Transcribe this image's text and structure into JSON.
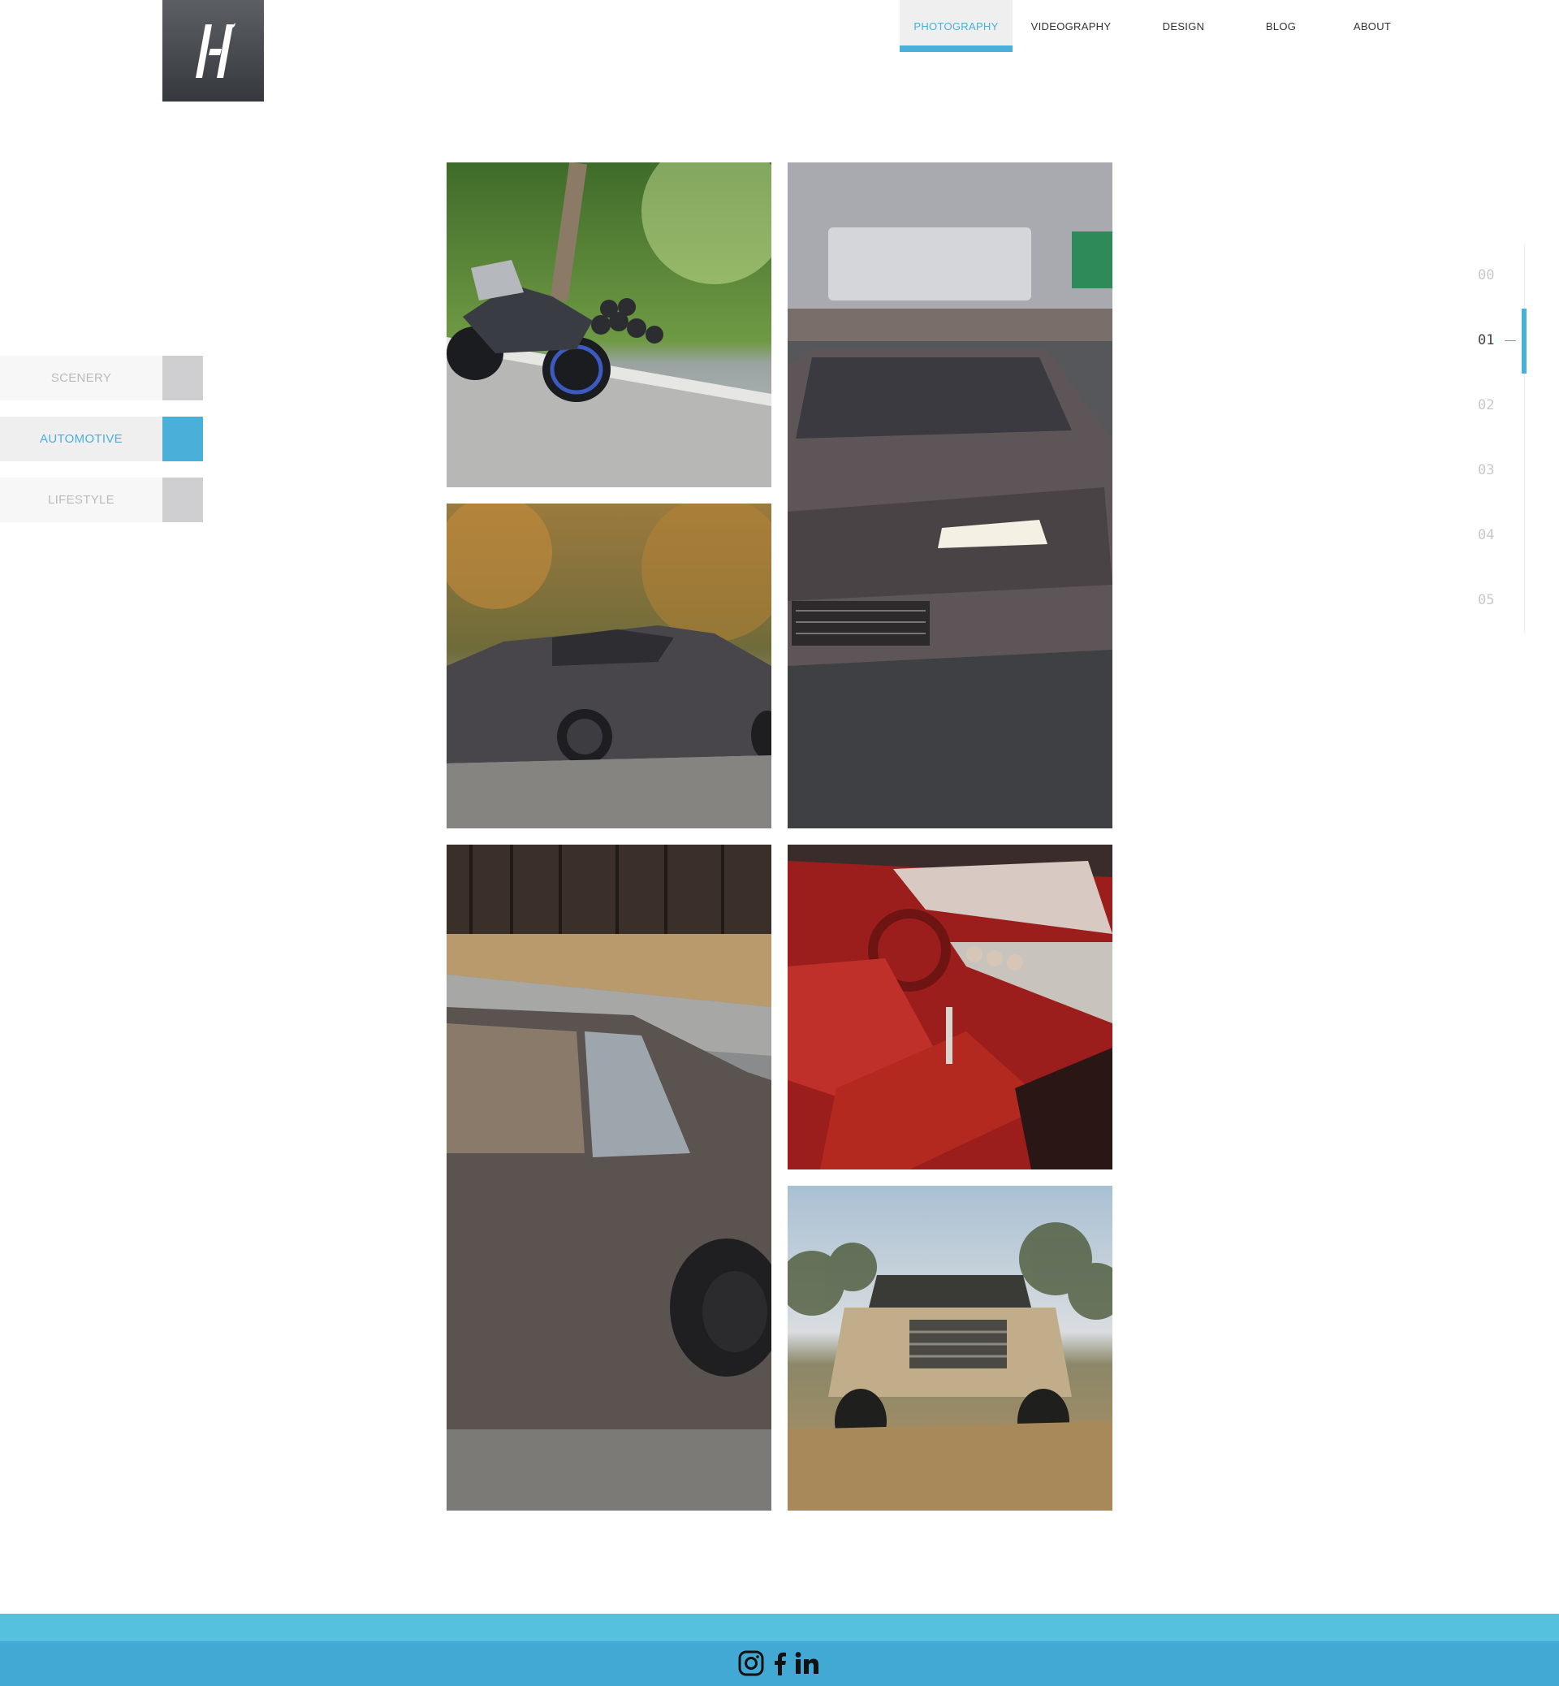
{
  "nav": {
    "items": [
      {
        "label": "PHOTOGRAPHY",
        "active": true
      },
      {
        "label": "VIDEOGRAPHY",
        "active": false
      },
      {
        "label": "DESIGN",
        "active": false
      },
      {
        "label": "BLOG",
        "active": false
      },
      {
        "label": "ABOUT",
        "active": false
      }
    ]
  },
  "categories": [
    {
      "label": "SCENERY",
      "active": false
    },
    {
      "label": "AUTOMOTIVE",
      "active": true
    },
    {
      "label": "LIFESTYLE",
      "active": false
    }
  ],
  "gallery": [
    {
      "subject": "motorcycle"
    },
    {
      "subject": "drift-car-front"
    },
    {
      "subject": "grey-coupe"
    },
    {
      "subject": "suv-side"
    },
    {
      "subject": "red-interior"
    },
    {
      "subject": "tan-pickup-truck"
    }
  ],
  "pager": {
    "items": [
      "00",
      "01",
      "02",
      "03",
      "04",
      "05"
    ],
    "active_index": 1
  },
  "footer": {
    "social": [
      "instagram-icon",
      "facebook-icon",
      "linkedin-icon"
    ]
  },
  "colors": {
    "accent": "#4ab0d9",
    "footer_top": "#56c1df",
    "footer": "#42a8d4",
    "logo_bg": "#474a4f"
  }
}
